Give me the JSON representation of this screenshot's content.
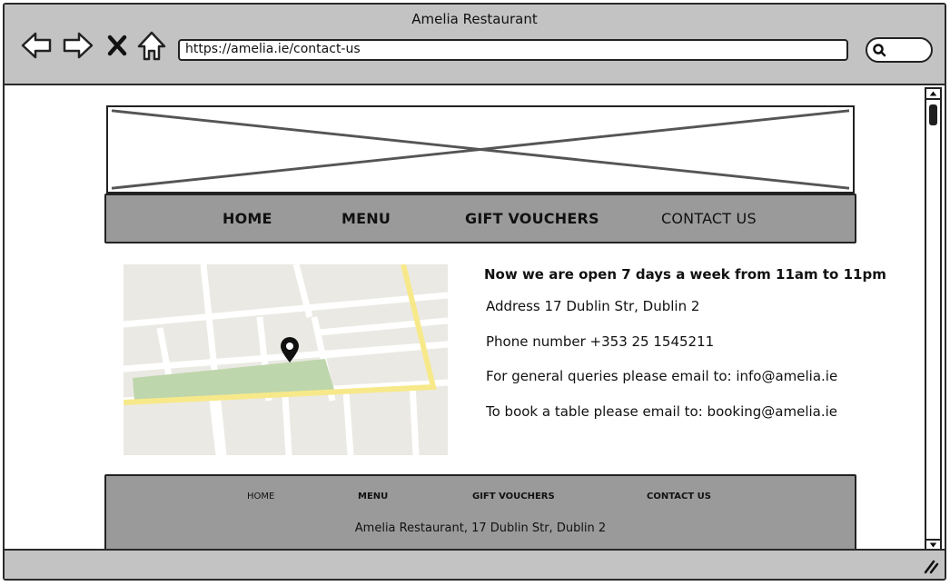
{
  "window": {
    "title": "Amelia Restaurant"
  },
  "browser": {
    "url": "https://amelia.ie/contact-us",
    "buttons": [
      "back-icon",
      "forward-icon",
      "close-icon",
      "home-icon"
    ],
    "search_icon": "search-icon"
  },
  "page": {
    "hero": {
      "kind": "image-placeholder"
    },
    "nav": {
      "items": [
        {
          "label": "HOME"
        },
        {
          "label": "MENU"
        },
        {
          "label": "GIFT VOUCHERS"
        },
        {
          "label": "CONTACT US"
        }
      ],
      "active": "CONTACT US"
    },
    "map": {
      "marker_icon": "map-pin-icon"
    },
    "contact": {
      "hours": "Now we are open 7 days a week from 11am to 11pm",
      "address": "Address 17 Dublin Str, Dublin 2",
      "phone": "Phone number +353 25 1545211",
      "general": "For general queries please email to: info@amelia.ie",
      "booking": "To book a table please email to: booking@amelia.ie"
    },
    "footer": {
      "items": [
        {
          "label": "HOME"
        },
        {
          "label": "MENU"
        },
        {
          "label": "GIFT VOUCHERS"
        },
        {
          "label": "CONTACT US"
        }
      ],
      "address": "Amelia Restaurant, 17 Dublin Str, Dublin 2"
    }
  },
  "colors": {
    "chrome": "#c3c3c3",
    "nav_background": "#9a9a9a",
    "border": "#222222",
    "map_land": "#ebe9e3",
    "map_road": "#ffffff",
    "map_main_road": "#f7e98a",
    "map_park": "#bed6ac"
  }
}
